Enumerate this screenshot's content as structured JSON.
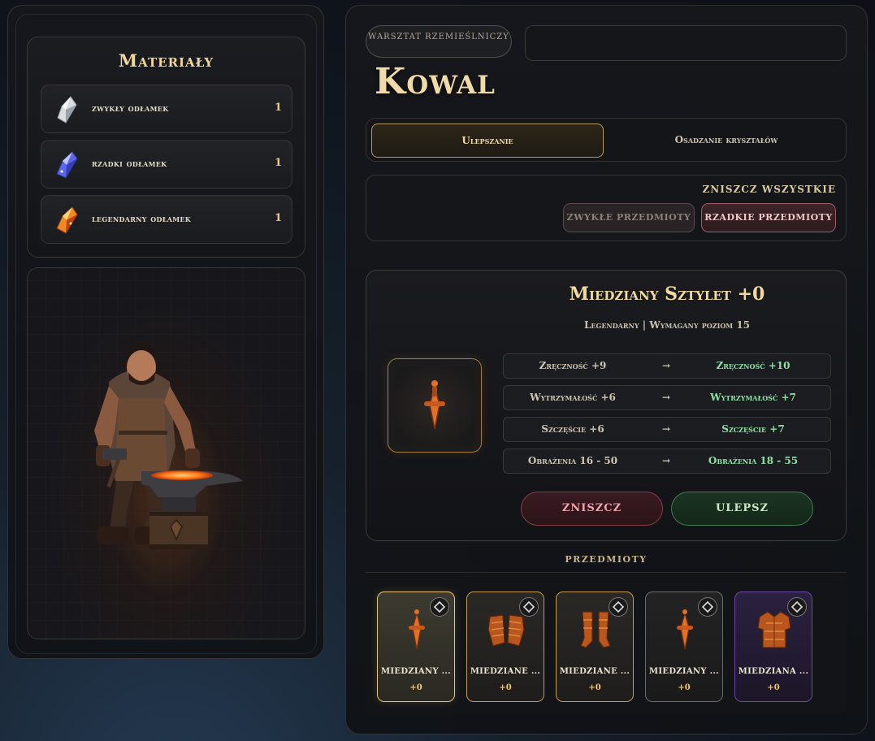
{
  "materials": {
    "title": "Materiały",
    "items": [
      {
        "label": "zwykły odłamek",
        "count": "1",
        "icon": "common-shard-icon",
        "color": "#c8ccd0"
      },
      {
        "label": "rzadki odłamek",
        "count": "1",
        "icon": "rare-shard-icon",
        "color": "#6f7df2"
      },
      {
        "label": "legendarny odłamek",
        "count": "1",
        "icon": "legendary-shard-icon",
        "color": "#f08a25"
      }
    ]
  },
  "header": {
    "badge": "WARSZTAT RZEMIEŚLNICZY",
    "title": "Kowal"
  },
  "tabs": {
    "upgrade": "Ulepszanie",
    "crystals": "Osadzanie kryształów"
  },
  "destroy_all": {
    "label": "ZNISZCZ WSZYSTKIE",
    "common": "ZWYKŁE PRZEDMIOTY",
    "rare": "RZADKIE PRZEDMIOTY"
  },
  "item": {
    "name": "Miedziany Sztylet +0",
    "meta": "Legendarny | Wymagany poziom 15",
    "icon": "copper-dagger-icon",
    "stats": [
      {
        "old": "Zręczność +9",
        "arrow": "→",
        "new": "Zręczność +10"
      },
      {
        "old": "Wytrzymałość +6",
        "arrow": "→",
        "new": "Wytrzymałość +7"
      },
      {
        "old": "Szczęście +6",
        "arrow": "→",
        "new": "Szczęście +7"
      },
      {
        "old": "Obrażenia 16 - 50",
        "arrow": "→",
        "new": "Obrażenia 18 - 55"
      }
    ],
    "destroy": "ZNISZCZ",
    "upgrade": "ULEPSZ"
  },
  "inventory": {
    "label": "PRZEDMIOTY",
    "items": [
      {
        "name": "MIEDZIANY ...",
        "level": "+0",
        "icon": "copper-dagger-icon",
        "rarity": "legendary"
      },
      {
        "name": "MIEDZIANE ...",
        "level": "+0",
        "icon": "copper-gauntlets-icon",
        "rarity": "legendary"
      },
      {
        "name": "MIEDZIANE ...",
        "level": "+0",
        "icon": "copper-boots-icon",
        "rarity": "legendary"
      },
      {
        "name": "MIEDZIANY ...",
        "level": "+0",
        "icon": "copper-dagger-icon",
        "rarity": "common"
      },
      {
        "name": "MIEDZIANA ...",
        "level": "+0",
        "icon": "copper-armor-icon",
        "rarity": "epic"
      }
    ]
  },
  "colors": {
    "gold": "#f2d9a0",
    "green": "#8fe0a5",
    "red": "#f3a2ab"
  }
}
